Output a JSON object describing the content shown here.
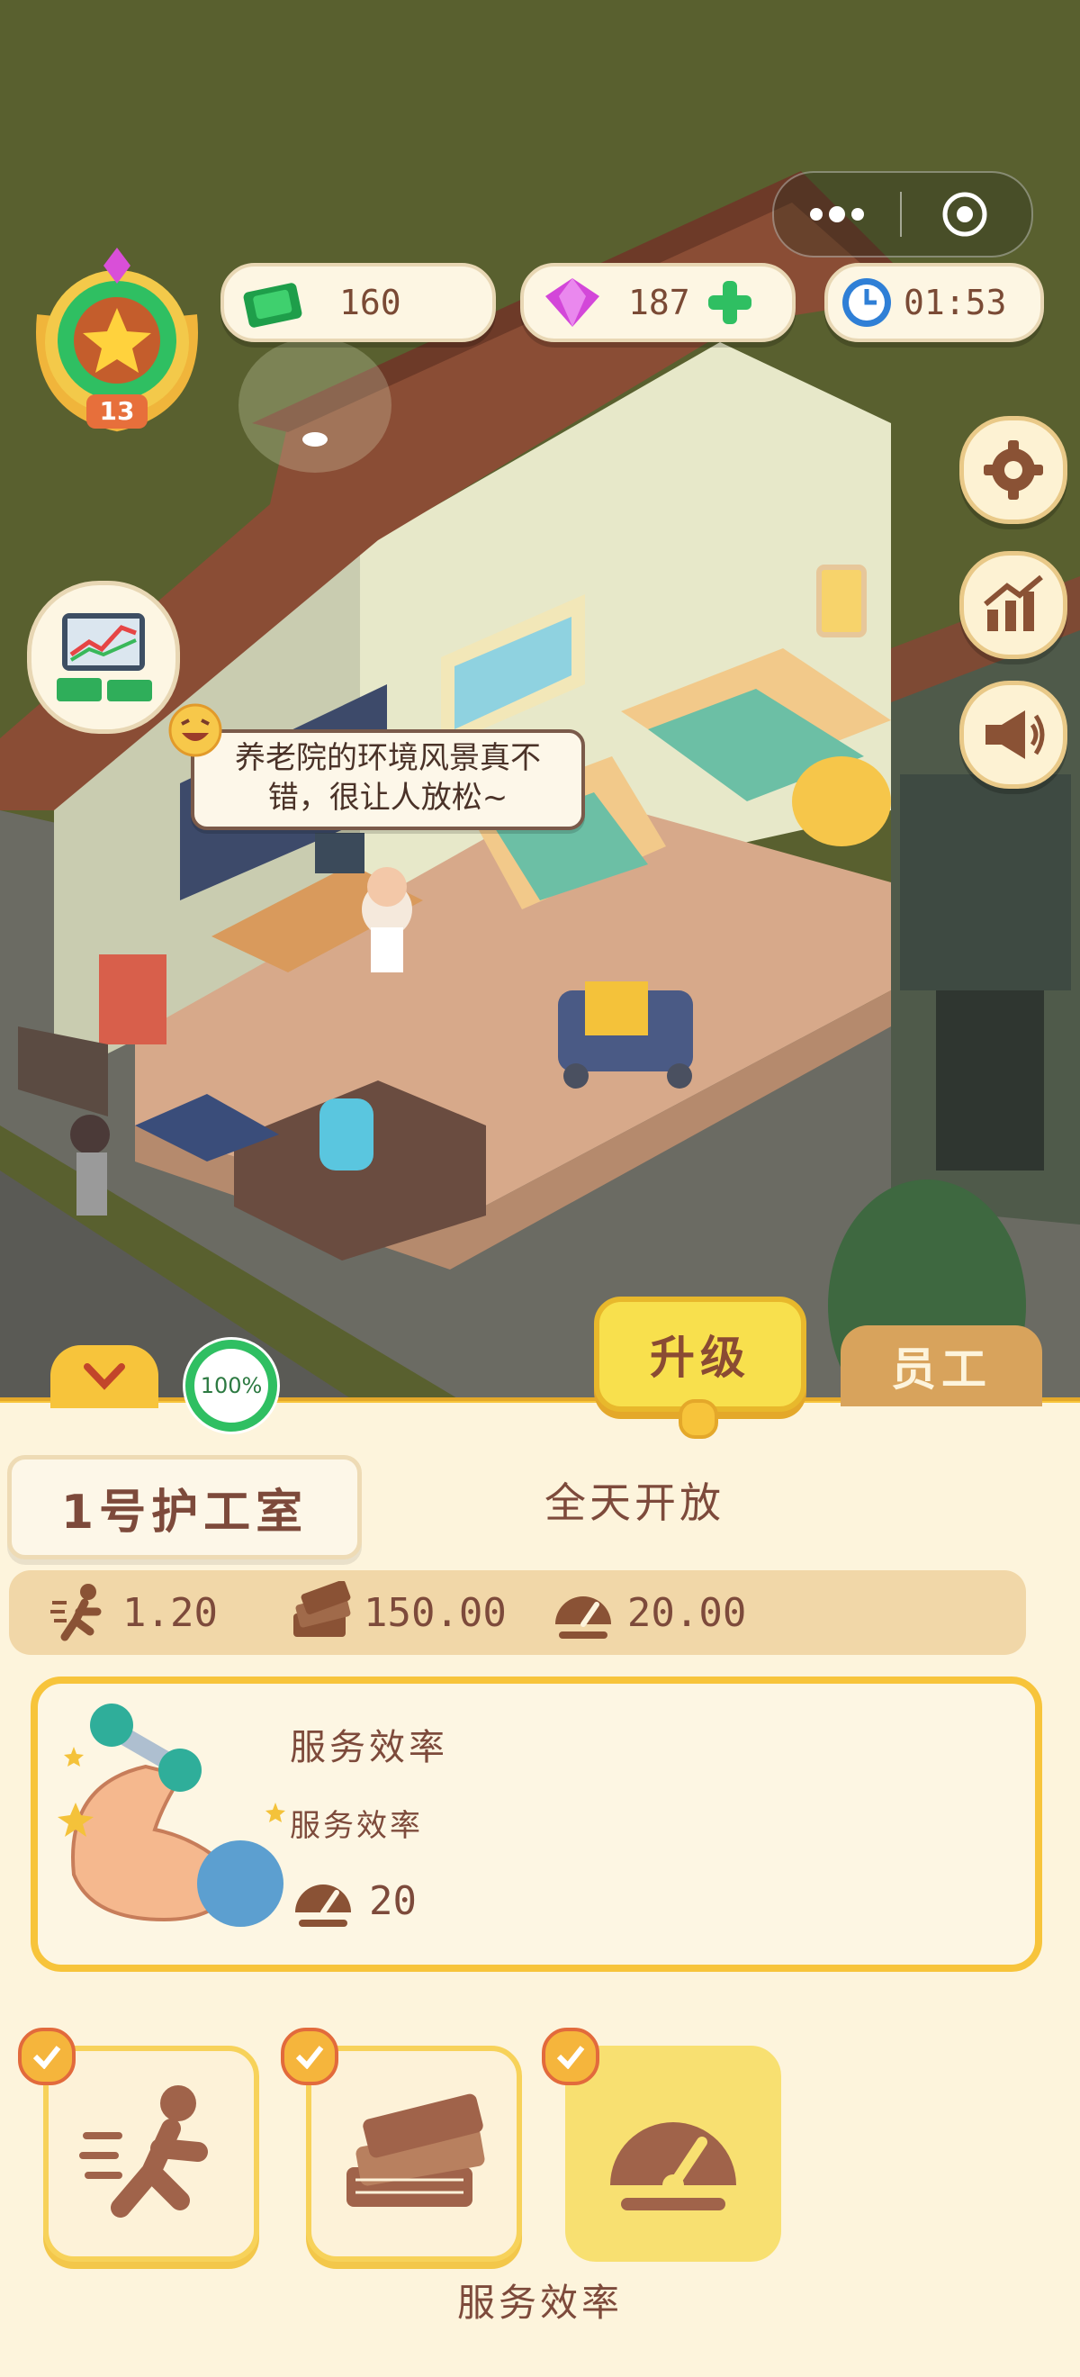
{
  "hud": {
    "level": "13",
    "cash": "160",
    "gems": "187",
    "timer": "01:53"
  },
  "scene": {
    "speech": "养老院的环境风景真不错，很让人放松~",
    "progress": "100%"
  },
  "tabs": {
    "upgrade": "升级",
    "staff": "员工"
  },
  "room": {
    "name": "1号护工室",
    "hours": "全天开放"
  },
  "stats": {
    "speed": "1.20",
    "income": "150.00",
    "efficiency": "20.00"
  },
  "detail": {
    "title": "服务效率",
    "subtitle": "服务效率",
    "value": "20"
  },
  "selected_label": "服务效率",
  "colors": {
    "accent_yellow": "#f7c43b",
    "text_brown": "#7d4a3b",
    "card_border": "#f7d25a",
    "green": "#2fbf62"
  }
}
